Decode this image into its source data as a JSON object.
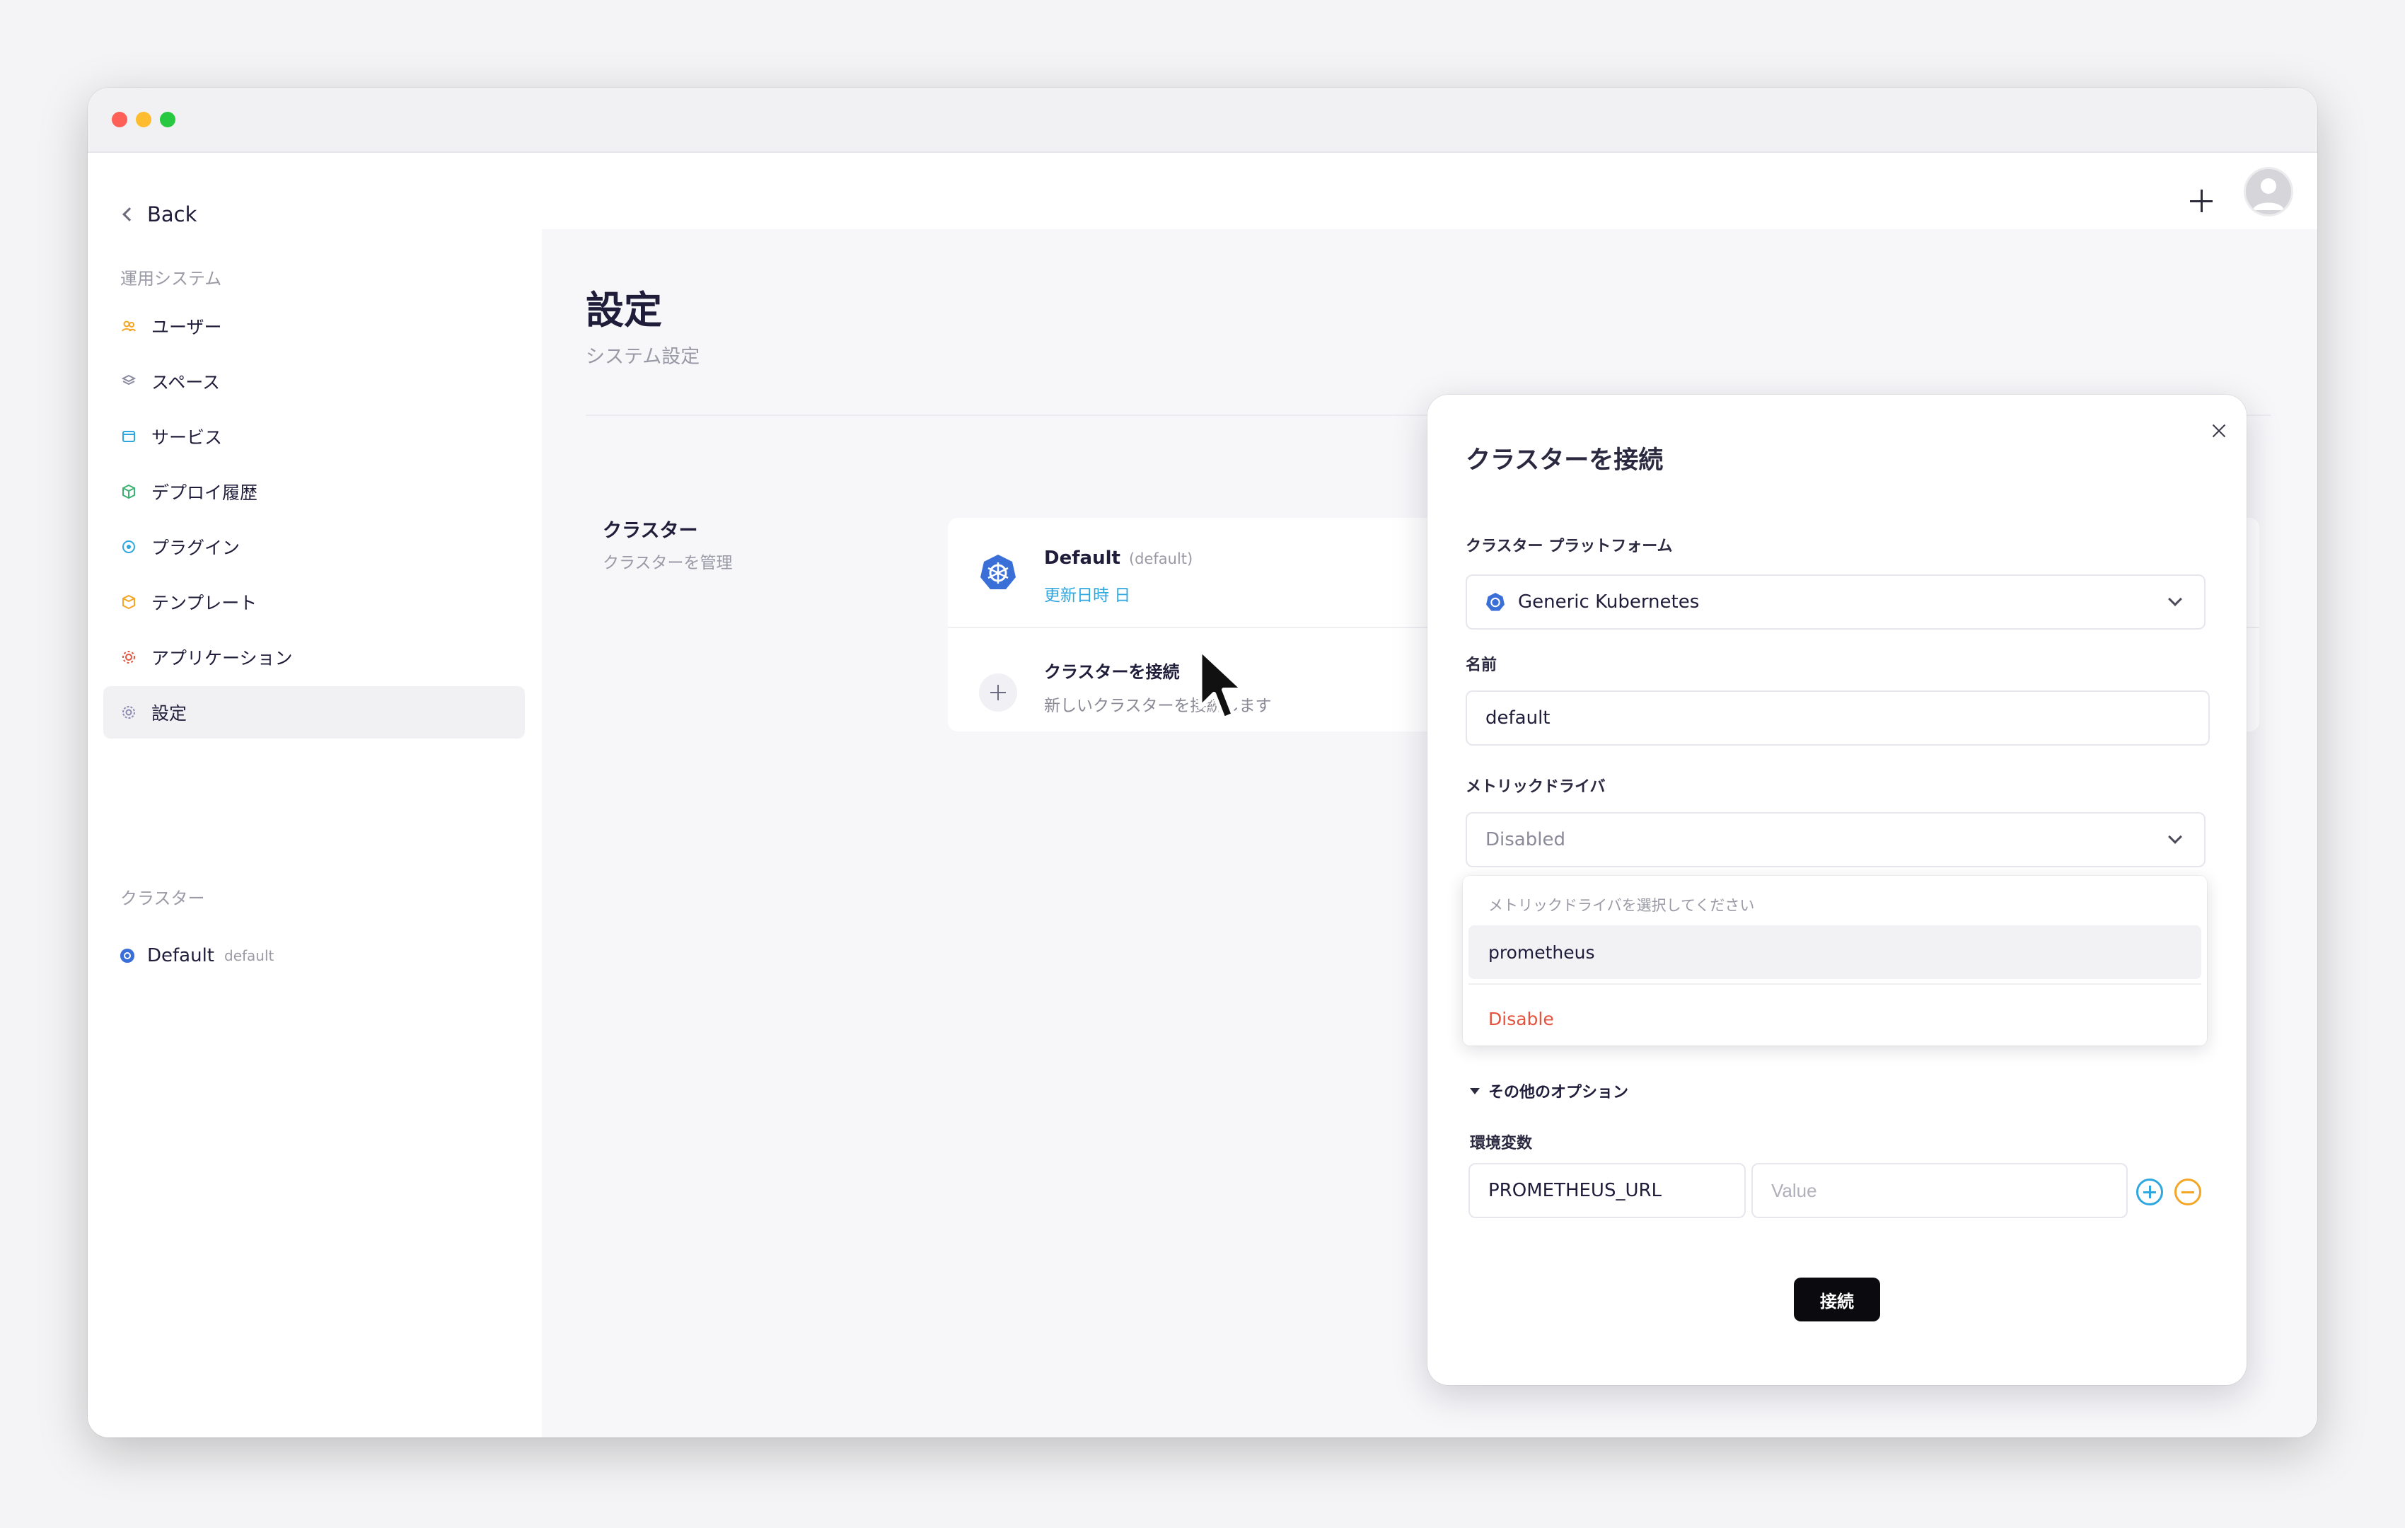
{
  "window": {
    "controls": [
      "close",
      "minimize",
      "maximize"
    ]
  },
  "sidebar": {
    "back_label": "Back",
    "section_system": "運用システム",
    "items": [
      {
        "label": "ユーザー",
        "icon": "users-icon"
      },
      {
        "label": "スペース",
        "icon": "layers-icon"
      },
      {
        "label": "サービス",
        "icon": "window-icon"
      },
      {
        "label": "デプロイ履歴",
        "icon": "box-icon"
      },
      {
        "label": "プラグイン",
        "icon": "plugin-icon"
      },
      {
        "label": "テンプレート",
        "icon": "package-icon"
      },
      {
        "label": "アプリケーション",
        "icon": "gear-app-icon"
      },
      {
        "label": "設定",
        "icon": "settings-icon"
      }
    ],
    "section_clusters": "クラスター",
    "cluster": {
      "name": "Default",
      "tag": "default"
    }
  },
  "main": {
    "title": "設定",
    "subtitle": "システム設定",
    "cluster_section": {
      "title": "クラスター",
      "subtitle": "クラスターを管理"
    },
    "cluster_card": {
      "name": "Default",
      "tag": "(default)",
      "updated": "更新日時  日"
    },
    "connect_row": {
      "title": "クラスターを接続",
      "subtitle": "新しいクラスターを接続します"
    }
  },
  "modal": {
    "title": "クラスターを接続",
    "platform_label": "クラスター プラットフォーム",
    "platform_value": "Generic Kubernetes",
    "name_label": "名前",
    "name_value": "default",
    "metrics_label": "メトリックドライバ",
    "metrics_value": "Disabled",
    "dropdown": {
      "hint": "メトリックドライバを選択してください",
      "options": [
        {
          "label": "prometheus"
        },
        {
          "label": "Disable"
        }
      ]
    },
    "more_options_label": "その他のオプション",
    "env_label": "環境変数",
    "env_key": "PROMETHEUS_URL",
    "env_value_placeholder": "Value",
    "submit_label": "接続"
  },
  "colors": {
    "accent": "#2ea7e0",
    "danger": "#e5533d",
    "warning": "#f5a524",
    "kubernetes": "#3b6fd8"
  }
}
